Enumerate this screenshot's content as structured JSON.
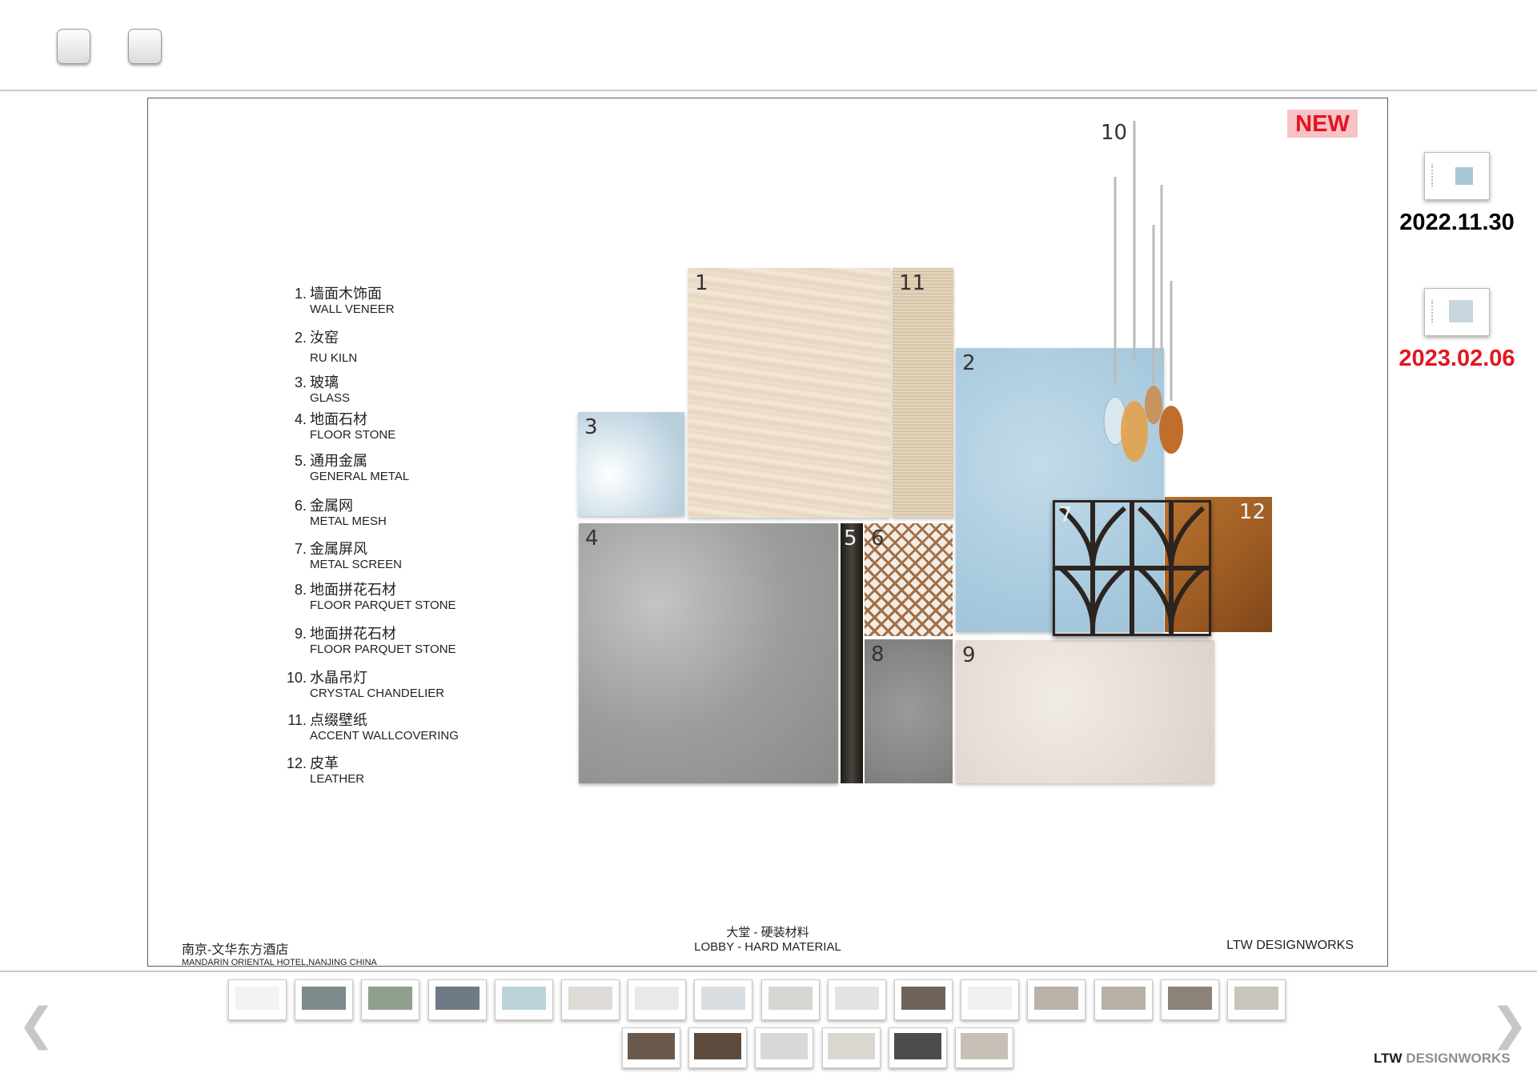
{
  "toolbar": {
    "buttons": [
      "button-1",
      "button-2"
    ]
  },
  "slide": {
    "badge": "NEW",
    "legend": [
      {
        "num": "1.",
        "zh": "墙面木饰面",
        "en": "WALL VENEER"
      },
      {
        "num": "2.",
        "zh": "汝窑",
        "en": "RU KILN"
      },
      {
        "num": "3.",
        "zh": "玻璃",
        "en": "GLASS"
      },
      {
        "num": "4.",
        "zh": "地面石材",
        "en": "FLOOR STONE"
      },
      {
        "num": "5.",
        "zh": "通用金属",
        "en": "GENERAL METAL"
      },
      {
        "num": "6.",
        "zh": "金属网",
        "en": "METAL MESH"
      },
      {
        "num": "7.",
        "zh": "金属屏风",
        "en": "METAL SCREEN"
      },
      {
        "num": "8.",
        "zh": "地面拼花石材",
        "en": "FLOOR PARQUET STONE"
      },
      {
        "num": "9.",
        "zh": "地面拼花石材",
        "en": "FLOOR PARQUET STONE"
      },
      {
        "num": "10.",
        "zh": "水晶吊灯",
        "en": "CRYSTAL CHANDELIER"
      },
      {
        "num": "11.",
        "zh": "点缀壁纸",
        "en": "ACCENT WALLCOVERING"
      },
      {
        "num": "12.",
        "zh": "皮革",
        "en": "LEATHER"
      }
    ],
    "swatch_labels": {
      "s1": "1",
      "s2": "2",
      "s3": "3",
      "s4": "4",
      "s5": "5",
      "s6": "6",
      "s7": "7",
      "s8": "8",
      "s9": "9",
      "s10": "10",
      "s11": "11",
      "s12": "12"
    },
    "footer": {
      "left_zh": "南京-文华东方酒店",
      "left_en": "MANDARIN ORIENTAL HOTEL,NANJING CHINA",
      "center_zh": "大堂 - 硬装材料",
      "center_en": "LOBBY - HARD MATERIAL",
      "right": "LTW DESIGNWORKS"
    }
  },
  "versions": [
    {
      "date": "2022.11.30",
      "color": "#000000"
    },
    {
      "date": "2023.02.06",
      "color": "#e2161f"
    }
  ],
  "filmstrip": {
    "row1_count": 16,
    "row2_count": 6,
    "prev_icon": "chevron-left-icon",
    "next_icon": "chevron-right-icon"
  },
  "brand": {
    "part1": "LTW",
    "part2": " DESIGNWORKS"
  },
  "colors": {
    "badge_bg": "#f7c3c6",
    "badge_text": "#e2161f",
    "active_version": "#e2161f"
  }
}
